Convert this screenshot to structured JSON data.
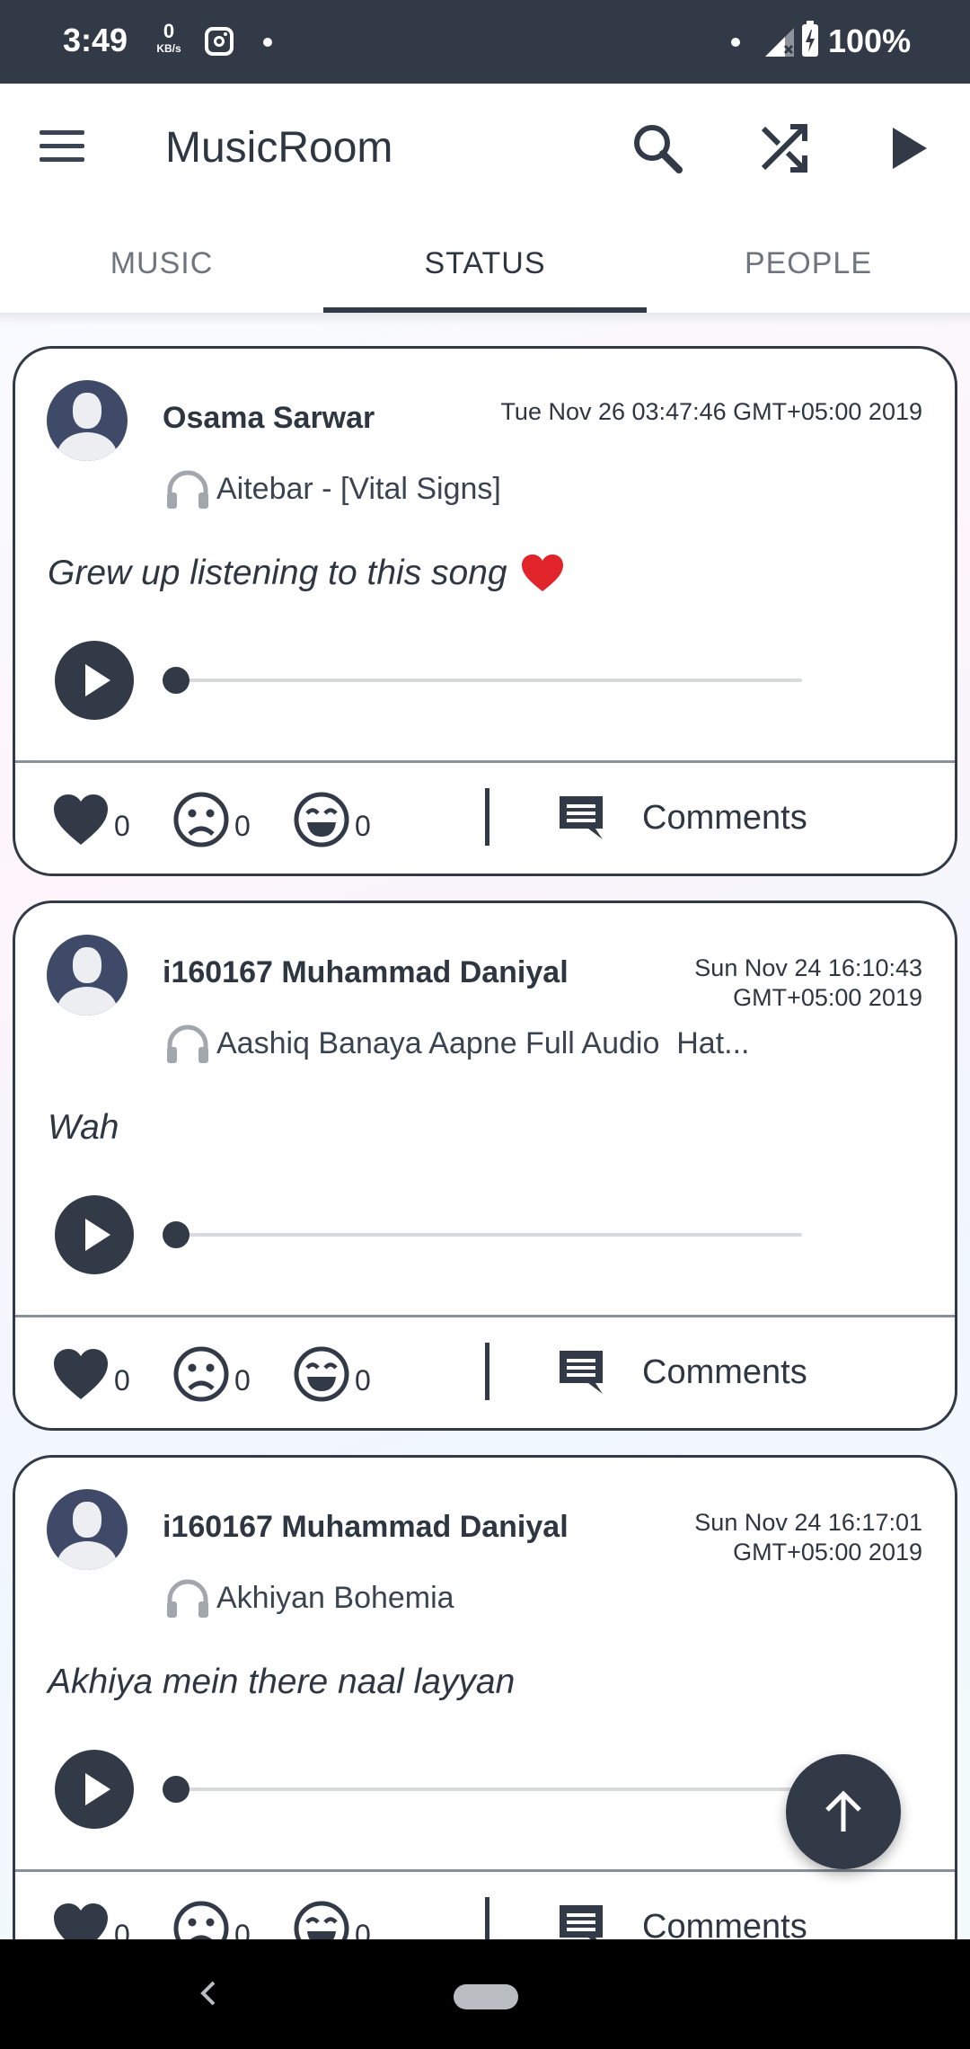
{
  "status_bar": {
    "time": "3:49",
    "net_speed_value": "0",
    "net_speed_unit": "KB/s",
    "battery": "100%"
  },
  "app_bar": {
    "title": "MusicRoom",
    "icons": [
      "menu-icon",
      "search-icon",
      "shuffle-icon",
      "play-icon"
    ]
  },
  "tabs": [
    {
      "label": "MUSIC",
      "active": false
    },
    {
      "label": "STATUS",
      "active": true
    },
    {
      "label": "PEOPLE",
      "active": false
    }
  ],
  "posts": [
    {
      "author": "Osama Sarwar",
      "date": "Tue Nov 26 03:47:46 GMT+05:00 2019",
      "song": "Aitebar - [Vital Signs]",
      "caption": "Grew up listening to this song",
      "caption_emoji": "heart",
      "likes": "0",
      "sad": "0",
      "laugh": "0",
      "comments_label": "Comments",
      "progress": 0
    },
    {
      "author": "i160167 Muhammad Daniyal",
      "date": "Sun Nov 24 16:10:43 GMT+05:00 2019",
      "song": "Aashiq Banaya Aapne Full Audio  Hat...",
      "caption": "Wah",
      "likes": "0",
      "sad": "0",
      "laugh": "0",
      "comments_label": "Comments",
      "progress": 0
    },
    {
      "author": "i160167 Muhammad Daniyal",
      "date": "Sun Nov 24 16:17:01 GMT+05:00 2019",
      "song": "Akhiyan Bohemia",
      "caption": "Akhiya mein there naal layyan",
      "likes": "0",
      "sad": "0",
      "laugh": "0",
      "comments_label": "Comments",
      "progress": 0
    }
  ],
  "fab_icon": "arrow-up-icon",
  "colors": {
    "primary": "#323a47",
    "text": "#2d3641",
    "tab_inactive": "#6e757e",
    "heart_emoji": "#e0242a"
  }
}
